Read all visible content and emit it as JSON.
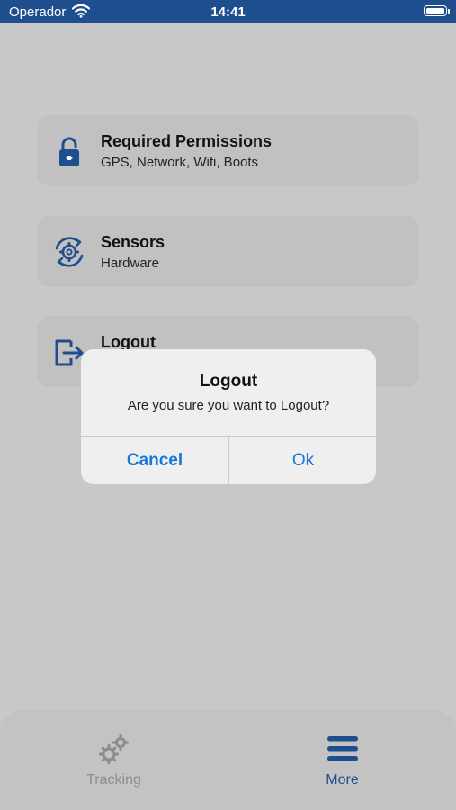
{
  "status_bar": {
    "carrier": "Operador",
    "time": "14:41",
    "icons": [
      "wifi-icon",
      "battery-icon"
    ]
  },
  "menu": {
    "items": [
      {
        "title": "Required Permissions",
        "subtitle": "GPS, Network, Wifi, Boots",
        "icon": "lock-icon"
      },
      {
        "title": "Sensors",
        "subtitle": "Hardware",
        "icon": "gear-sync-icon"
      },
      {
        "title": "Logout",
        "subtitle": "",
        "icon": "logout-icon"
      }
    ]
  },
  "dialog": {
    "title": "Logout",
    "message": "Are you sure you want to Logout?",
    "cancel_label": "Cancel",
    "ok_label": "Ok"
  },
  "tab_bar": {
    "tabs": [
      {
        "label": "Tracking",
        "icon": "gears-icon",
        "active": false
      },
      {
        "label": "More",
        "icon": "menu-icon",
        "active": true
      }
    ]
  },
  "colors": {
    "primary": "#1f4e8f",
    "link": "#1877d6",
    "inactive": "#8d8d8d",
    "overlay_background": "#c8c8c8"
  }
}
